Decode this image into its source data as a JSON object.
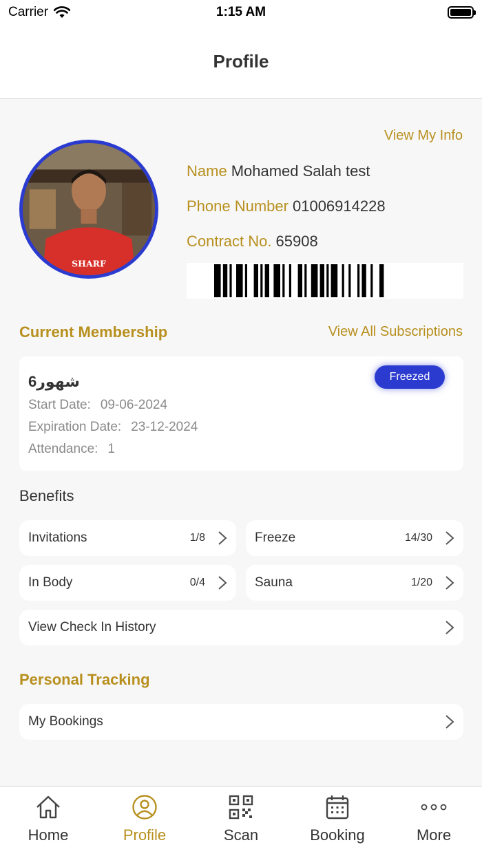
{
  "status_bar": {
    "carrier": "Carrier",
    "time": "1:15 AM"
  },
  "header": {
    "title": "Profile"
  },
  "profile": {
    "view_info_label": "View My Info",
    "name_label": "Name",
    "name_value": "Mohamed Salah test",
    "phone_label": "Phone Number",
    "phone_value": "01006914228",
    "contract_label": "Contract No.",
    "contract_value": "65908"
  },
  "membership": {
    "section_title": "Current Membership",
    "view_all_label": "View All Subscriptions",
    "plan_name": "6شهور",
    "status": "Freezed",
    "start_label": "Start Date:",
    "start_value": "09-06-2024",
    "expiration_label": "Expiration Date:",
    "expiration_value": "23-12-2024",
    "attendance_label": "Attendance:",
    "attendance_value": "1"
  },
  "benefits": {
    "title": "Benefits",
    "items": [
      {
        "label": "Invitations",
        "count": "1/8"
      },
      {
        "label": "Freeze",
        "count": "14/30"
      },
      {
        "label": "In Body",
        "count": "0/4"
      },
      {
        "label": "Sauna",
        "count": "1/20"
      }
    ],
    "history_label": "View Check In History"
  },
  "tracking": {
    "section_title": "Personal Tracking",
    "bookings_label": "My Bookings"
  },
  "tabs": [
    {
      "label": "Home",
      "icon": "home-icon"
    },
    {
      "label": "Profile",
      "icon": "profile-icon"
    },
    {
      "label": "Scan",
      "icon": "qr-code-icon"
    },
    {
      "label": "Booking",
      "icon": "calendar-icon"
    },
    {
      "label": "More",
      "icon": "more-icon"
    }
  ],
  "colors": {
    "accent": "#b8901f",
    "badge": "#2b3bd0",
    "background": "#f7f7f7"
  }
}
